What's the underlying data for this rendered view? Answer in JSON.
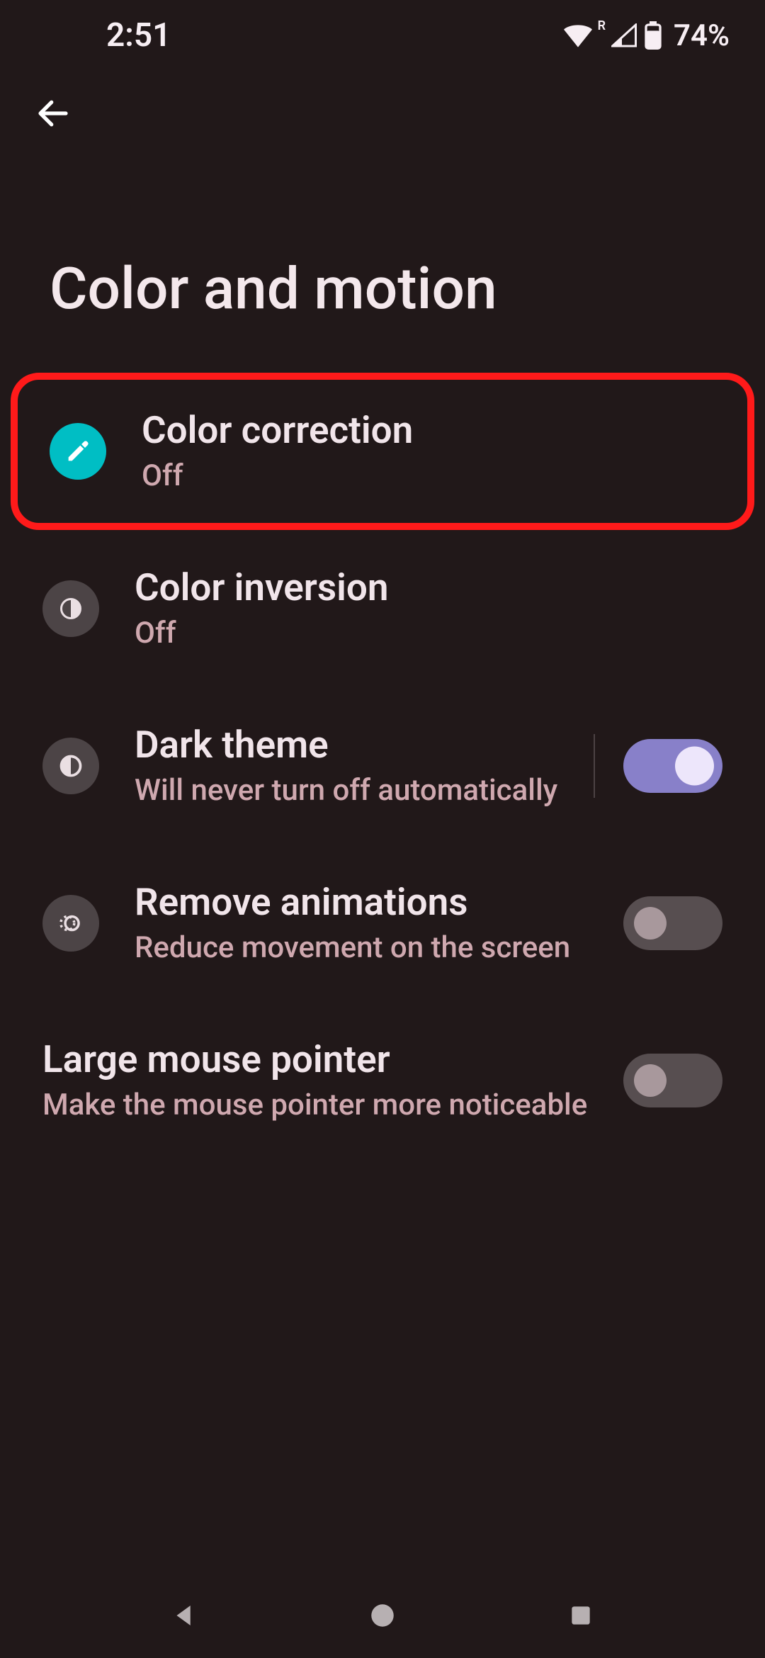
{
  "status": {
    "time": "2:51",
    "battery": "74%"
  },
  "page": {
    "title": "Color and motion"
  },
  "items": {
    "color_correction": {
      "title": "Color correction",
      "subtitle": "Off"
    },
    "color_inversion": {
      "title": "Color inversion",
      "subtitle": "Off"
    },
    "dark_theme": {
      "title": "Dark theme",
      "subtitle": "Will never turn off automatically",
      "toggle": true
    },
    "remove_animations": {
      "title": "Remove animations",
      "subtitle": "Reduce movement on the screen",
      "toggle": false
    },
    "large_mouse_pointer": {
      "title": "Large mouse pointer",
      "subtitle": "Make the mouse pointer more noticeable",
      "toggle": false
    }
  },
  "colors": {
    "accent_teal": "#00bec4",
    "toggle_on": "#8880c9",
    "highlight": "#ff1a1a"
  }
}
